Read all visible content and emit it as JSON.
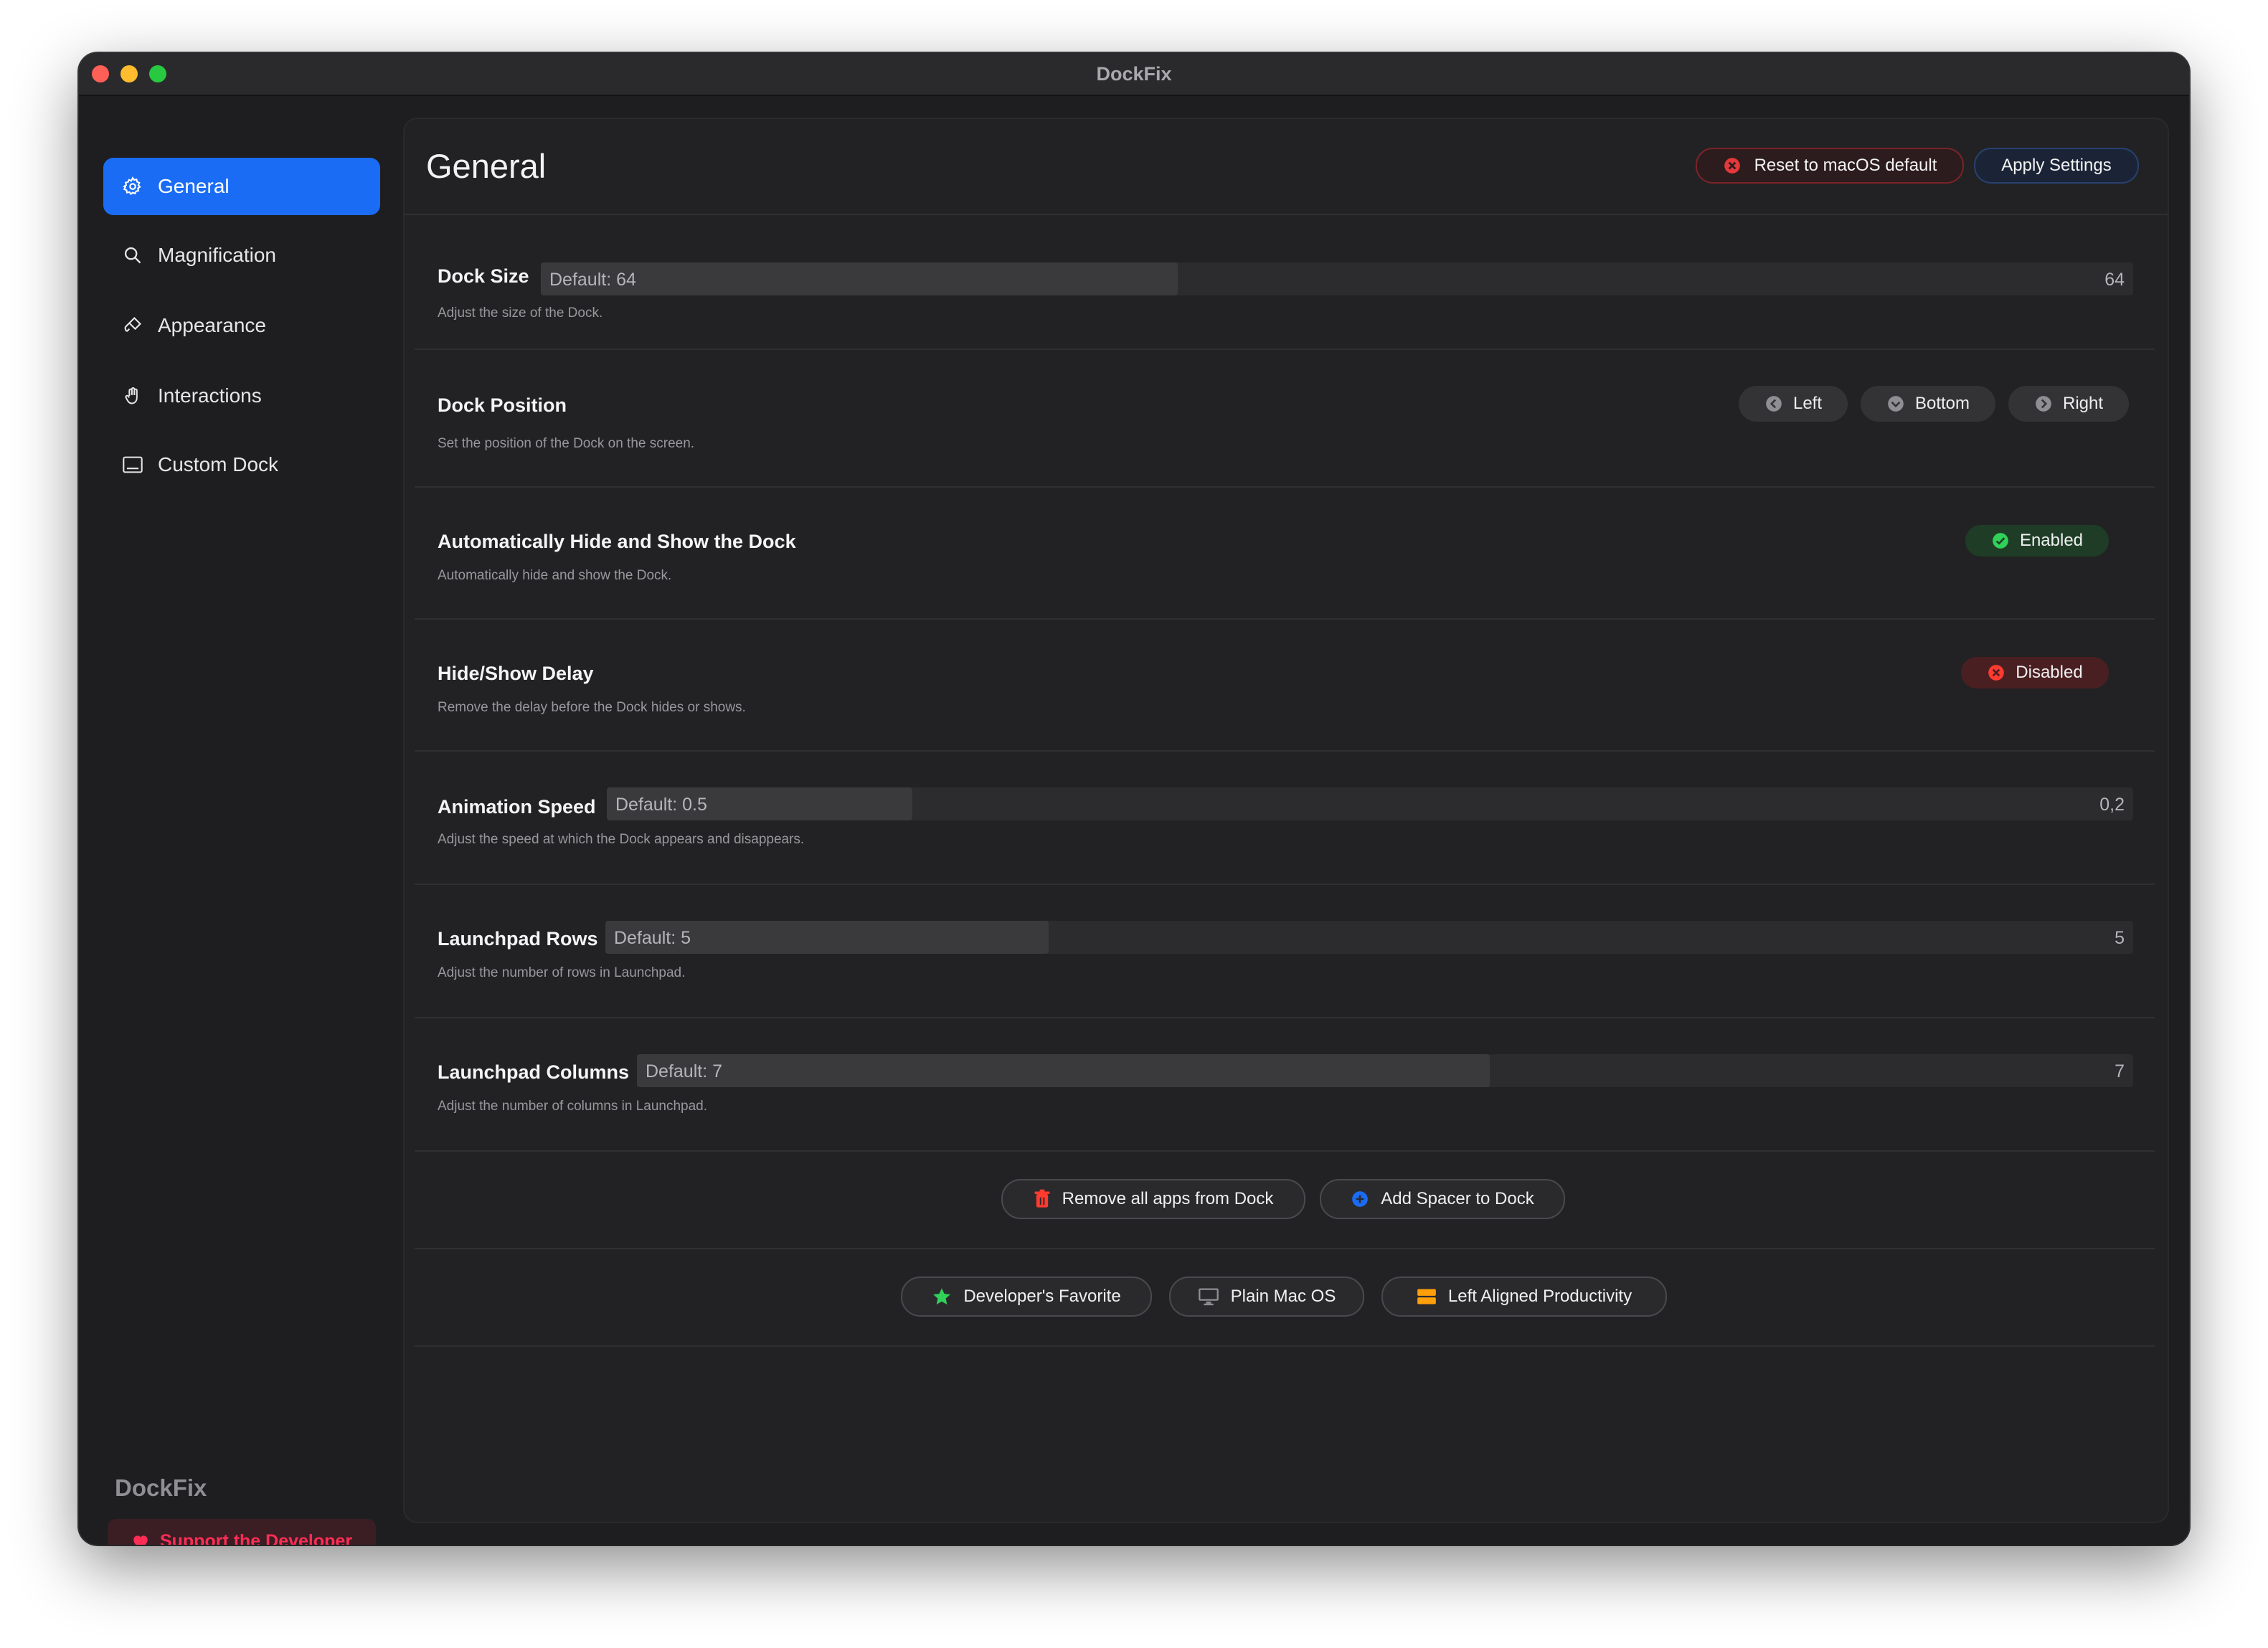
{
  "window": {
    "title": "DockFix"
  },
  "sidebar": {
    "items": [
      {
        "label": "General",
        "icon": "gear-icon",
        "active": true
      },
      {
        "label": "Magnification",
        "icon": "magnifier-icon",
        "active": false
      },
      {
        "label": "Appearance",
        "icon": "paintbrush-icon",
        "active": false
      },
      {
        "label": "Interactions",
        "icon": "hand-icon",
        "active": false
      },
      {
        "label": "Custom Dock",
        "icon": "dock-icon",
        "active": false
      }
    ],
    "brand": "DockFix",
    "support_label": "Support the Developer"
  },
  "header": {
    "title": "General",
    "reset_label": "Reset to macOS default",
    "apply_label": "Apply Settings"
  },
  "settings": {
    "dock_size": {
      "title": "Dock Size",
      "default_label": "Default: 64",
      "value": "64",
      "fill_fraction": 0.4,
      "desc": "Adjust the size of the Dock."
    },
    "dock_position": {
      "title": "Dock Position",
      "desc": "Set the position of the Dock on the screen.",
      "options": [
        "Left",
        "Bottom",
        "Right"
      ]
    },
    "auto_hide": {
      "title": "Automatically Hide and Show the Dock",
      "desc": "Automatically hide and show the Dock.",
      "status": "Enabled"
    },
    "hide_delay": {
      "title": "Hide/Show Delay",
      "desc": "Remove the delay before the Dock hides or shows.",
      "status": "Disabled"
    },
    "animation_speed": {
      "title": "Animation Speed",
      "default_label": "Default: 0.5",
      "value": "0,2",
      "fill_fraction": 0.2,
      "desc": "Adjust the speed at which the Dock appears and disappears."
    },
    "launchpad_rows": {
      "title": "Launchpad Rows",
      "default_label": "Default: 5",
      "value": "5",
      "fill_fraction": 0.29,
      "desc": "Adjust the number of rows in Launchpad."
    },
    "launchpad_columns": {
      "title": "Launchpad Columns",
      "default_label": "Default: 7",
      "value": "7",
      "fill_fraction": 0.57,
      "desc": "Adjust the number of columns in Launchpad."
    }
  },
  "actions": {
    "remove_all": "Remove all apps from Dock",
    "add_spacer": "Add Spacer to Dock"
  },
  "presets": {
    "favorite": "Developer's Favorite",
    "plain": "Plain Mac OS",
    "left_aligned": "Left Aligned Productivity"
  },
  "colors": {
    "accent": "#1a6cf4",
    "danger": "#ff3b30",
    "success": "#30d158",
    "support": "#ff2d55"
  }
}
